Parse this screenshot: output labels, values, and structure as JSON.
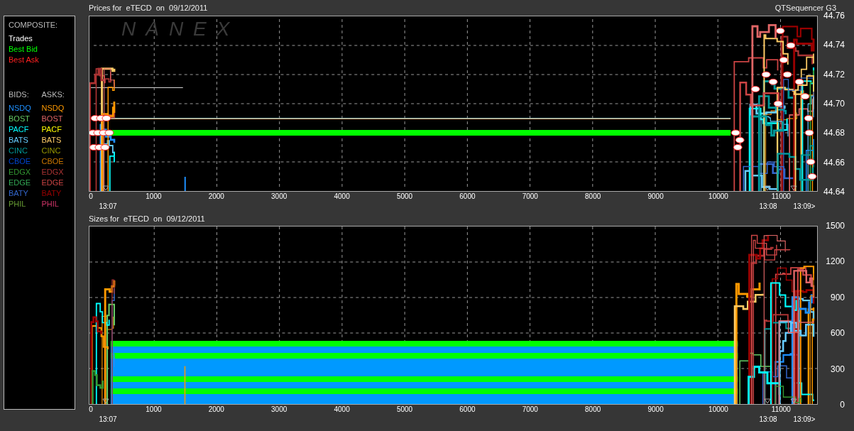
{
  "legend": {
    "composite_heading": "COMPOSITE:",
    "composite": [
      {
        "label": "Trades",
        "color": "#ffffff"
      },
      {
        "label": "Best Bid",
        "color": "#00ff00"
      },
      {
        "label": "Best Ask",
        "color": "#ff2020"
      }
    ],
    "bids_heading": "BIDS:",
    "asks_heading": "ASKS:",
    "exchanges": [
      {
        "bid": {
          "label": "NSDQ",
          "color": "#1e90ff"
        },
        "ask": {
          "label": "NSDQ",
          "color": "#ff9900"
        }
      },
      {
        "bid": {
          "label": "BOST",
          "color": "#66cc66"
        },
        "ask": {
          "label": "BOST",
          "color": "#e06666"
        }
      },
      {
        "bid": {
          "label": "PACF",
          "color": "#00ffff"
        },
        "ask": {
          "label": "PACF",
          "color": "#ffff00"
        }
      },
      {
        "bid": {
          "label": "BATS",
          "color": "#66ccff"
        },
        "ask": {
          "label": "BATS",
          "color": "#ffcc66"
        }
      },
      {
        "bid": {
          "label": "CINC",
          "color": "#009999"
        },
        "ask": {
          "label": "CINC",
          "color": "#999900"
        }
      },
      {
        "bid": {
          "label": "CBOE",
          "color": "#0044cc"
        },
        "ask": {
          "label": "CBOE",
          "color": "#cc7700"
        }
      },
      {
        "bid": {
          "label": "EDGX",
          "color": "#339933"
        },
        "ask": {
          "label": "EDGX",
          "color": "#aa3333"
        }
      },
      {
        "bid": {
          "label": "EDGE",
          "color": "#33aa55"
        },
        "ask": {
          "label": "EDGE",
          "color": "#cc4444"
        }
      },
      {
        "bid": {
          "label": "BATY",
          "color": "#3366cc"
        },
        "ask": {
          "label": "BATY",
          "color": "#990000"
        }
      },
      {
        "bid": {
          "label": "PHIL",
          "color": "#669933"
        },
        "ask": {
          "label": "PHIL",
          "color": "#cc3366"
        }
      }
    ]
  },
  "app_label": "QTSequencer G3",
  "panels": [
    {
      "kind": "prices",
      "title": "Prices for  eTECD  on  09/12/2011",
      "watermark": "NANEX",
      "y_ticks": [
        "44.76",
        "44.74",
        "44.72",
        "44.70",
        "44.68",
        "44.66",
        "44.64"
      ],
      "x_ticks": [
        "0",
        "1000",
        "2000",
        "3000",
        "4000",
        "5000",
        "6000",
        "7000",
        "8000",
        "9000",
        "10000",
        "11000"
      ],
      "time_labels": [
        "13:07",
        "13:08",
        "13:09>"
      ]
    },
    {
      "kind": "sizes",
      "title": "Sizes for  eTECD  on  09/12/2011",
      "y_ticks": [
        "1500",
        "1200",
        "900",
        "600",
        "300",
        "0"
      ],
      "x_ticks": [
        "0",
        "1000",
        "2000",
        "3000",
        "4000",
        "5000",
        "6000",
        "7000",
        "8000",
        "9000",
        "10000",
        "11000"
      ],
      "time_labels": [
        "13:07",
        "13:08",
        "13:09>"
      ]
    }
  ]
}
